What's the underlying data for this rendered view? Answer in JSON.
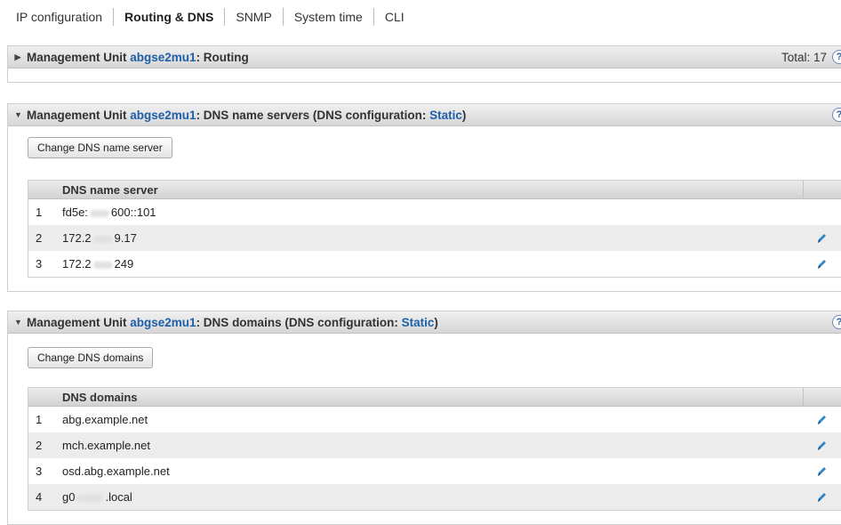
{
  "tabs": [
    {
      "label": "IP configuration",
      "active": false
    },
    {
      "label": "Routing & DNS",
      "active": true
    },
    {
      "label": "SNMP",
      "active": false
    },
    {
      "label": "System time",
      "active": false
    },
    {
      "label": "CLI",
      "active": false
    }
  ],
  "routing": {
    "prefix": "Management Unit ",
    "unit": "abgse2mu1",
    "title": ": Routing",
    "total": "Total: 17",
    "collapsed": true
  },
  "dns_servers": {
    "prefix": "Management Unit ",
    "unit": "abgse2mu1",
    "title": ": DNS name servers (DNS configuration: ",
    "mode": "Static",
    "close": ")",
    "button": "Change DNS name server",
    "column": "DNS name server",
    "rows": [
      {
        "n": "1",
        "a": "fd5e:",
        "b": "600::101",
        "editable": false
      },
      {
        "n": "2",
        "a": "172.2",
        "b": "9.17",
        "editable": true
      },
      {
        "n": "3",
        "a": "172.2",
        "b": "249",
        "editable": true
      }
    ]
  },
  "dns_domains": {
    "prefix": "Management Unit ",
    "unit": "abgse2mu1",
    "title": ": DNS domains (DNS configuration: ",
    "mode": "Static",
    "close": ")",
    "button": "Change DNS domains",
    "column": "DNS domains",
    "rows": [
      {
        "n": "1",
        "a": "abg.example.net",
        "b": "",
        "editable": true
      },
      {
        "n": "2",
        "a": "mch.example.net",
        "b": "",
        "editable": true
      },
      {
        "n": "3",
        "a": "osd.abg.example.net",
        "b": "",
        "editable": true
      },
      {
        "n": "4",
        "a": "g0",
        "b": ".local",
        "editable": true
      }
    ]
  },
  "help_glyph": "?",
  "icons": {
    "collapsed": "triangle-right-icon",
    "expanded": "triangle-down-icon",
    "edit": "edit-pencil-icon",
    "help": "help-icon"
  },
  "colors": {
    "link": "#1f5fa8",
    "edit_icon": "#2f86c8"
  }
}
